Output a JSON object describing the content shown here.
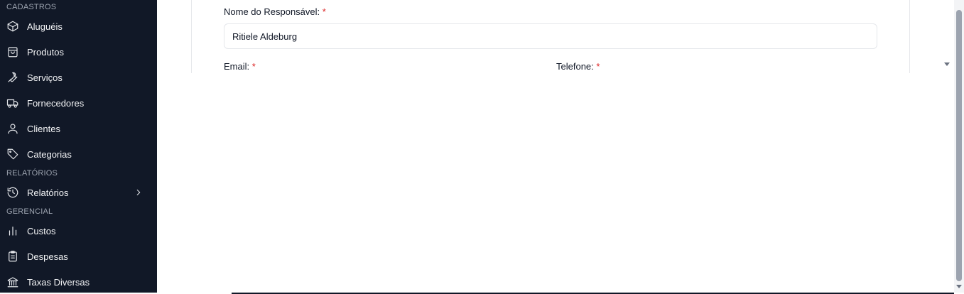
{
  "sidebar": {
    "sections": [
      {
        "label": "CADASTROS",
        "items": [
          {
            "label": "Aluguéis",
            "icon": "box-icon"
          },
          {
            "label": "Produtos",
            "icon": "shopping-bag-icon"
          },
          {
            "label": "Serviços",
            "icon": "wrench-icon"
          },
          {
            "label": "Fornecedores",
            "icon": "truck-icon"
          },
          {
            "label": "Clientes",
            "icon": "user-icon"
          },
          {
            "label": "Categorias",
            "icon": "tag-icon"
          }
        ]
      },
      {
        "label": "RELATÓRIOS",
        "items": [
          {
            "label": "Relatórios",
            "icon": "history-icon",
            "has_submenu": true
          }
        ]
      },
      {
        "label": "GERENCIAL",
        "items": [
          {
            "label": "Custos",
            "icon": "bar-chart-icon"
          },
          {
            "label": "Despesas",
            "icon": "clipboard-icon"
          },
          {
            "label": "Taxas Diversas",
            "icon": "bank-icon"
          }
        ]
      }
    ]
  },
  "form": {
    "responsavel_label": "Nome do Responsável:",
    "responsavel_value": "Ritiele Aldeburg",
    "email_label": "Email:",
    "telefone_label": "Telefone:",
    "required_mark": "*"
  },
  "colors": {
    "sidebar_bg": "#111827",
    "required": "#dc2626"
  }
}
